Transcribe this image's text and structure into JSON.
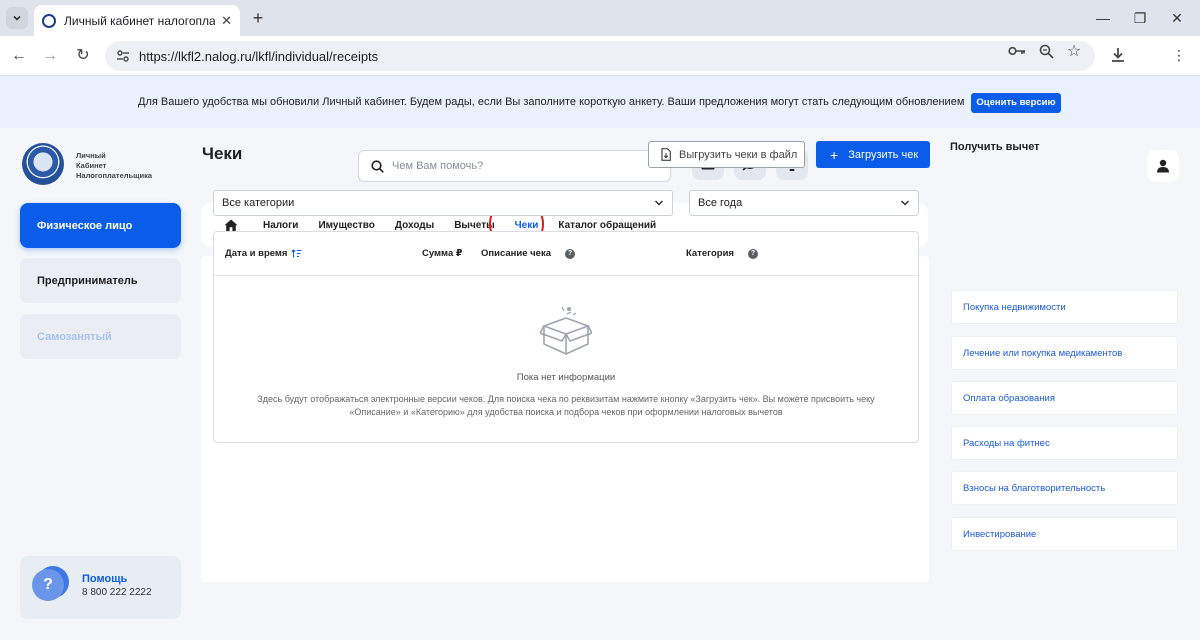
{
  "browser": {
    "tab_title": "Личный кабинет налогоплате",
    "url": "https://lkfl2.nalog.ru/lkfl/individual/receipts"
  },
  "banner": {
    "text": "Для Вашего удобства мы обновили Личный кабинет. Будем рады, если Вы заполните короткую анкету. Ваши предложения могут стать следующим обновлением",
    "button": "Оценить версию"
  },
  "header": {
    "logo_lines": [
      "Личный",
      "Кабинет",
      "Налогоплательщика"
    ],
    "search_placeholder": "Чем Вам помочь?"
  },
  "sidebar": {
    "items": [
      {
        "label": "Физическое лицо"
      },
      {
        "label": "Предприниматель"
      },
      {
        "label": "Самозанятый"
      }
    ],
    "help": {
      "title": "Помощь",
      "phone": "8 800 222 2222",
      "avatar": "?"
    }
  },
  "nav": {
    "items": [
      {
        "label": "Налоги"
      },
      {
        "label": "Имущество"
      },
      {
        "label": "Доходы"
      },
      {
        "label": "Вычеты"
      },
      {
        "label": "Чеки"
      },
      {
        "label": "Каталог обращений"
      }
    ]
  },
  "main": {
    "title": "Чеки",
    "export_button": "Выгрузить чеки в файл",
    "upload_button": "Загрузить чек",
    "category_select": "Все категории",
    "year_select": "Все года",
    "columns": {
      "date": "Дата и время",
      "sum": "Сумма ₽",
      "description": "Описание чека",
      "category": "Категория"
    },
    "empty_title": "Пока нет информации",
    "empty_desc": "Здесь будут отображаться электронные версии чеков. Для поиска чека по реквизитам нажмите кнопку «Загрузить чек». Вы можете присвоить чеку «Описание» и «Категорию» для удобства поиска и подбора чеков при оформлении налоговых вычетов"
  },
  "right_panel": {
    "title": "Получить вычет",
    "items": [
      {
        "label": "Покупка недвижимости"
      },
      {
        "label": "Лечение или покупка медикаментов"
      },
      {
        "label": "Оплата образования"
      },
      {
        "label": "Расходы на фитнес"
      },
      {
        "label": "Взносы на благотворительность"
      },
      {
        "label": "Инвестирование"
      }
    ]
  },
  "colors": {
    "accent": "#0a5de8",
    "annotation": "#e01b1b",
    "background": "#f4f6f9"
  }
}
